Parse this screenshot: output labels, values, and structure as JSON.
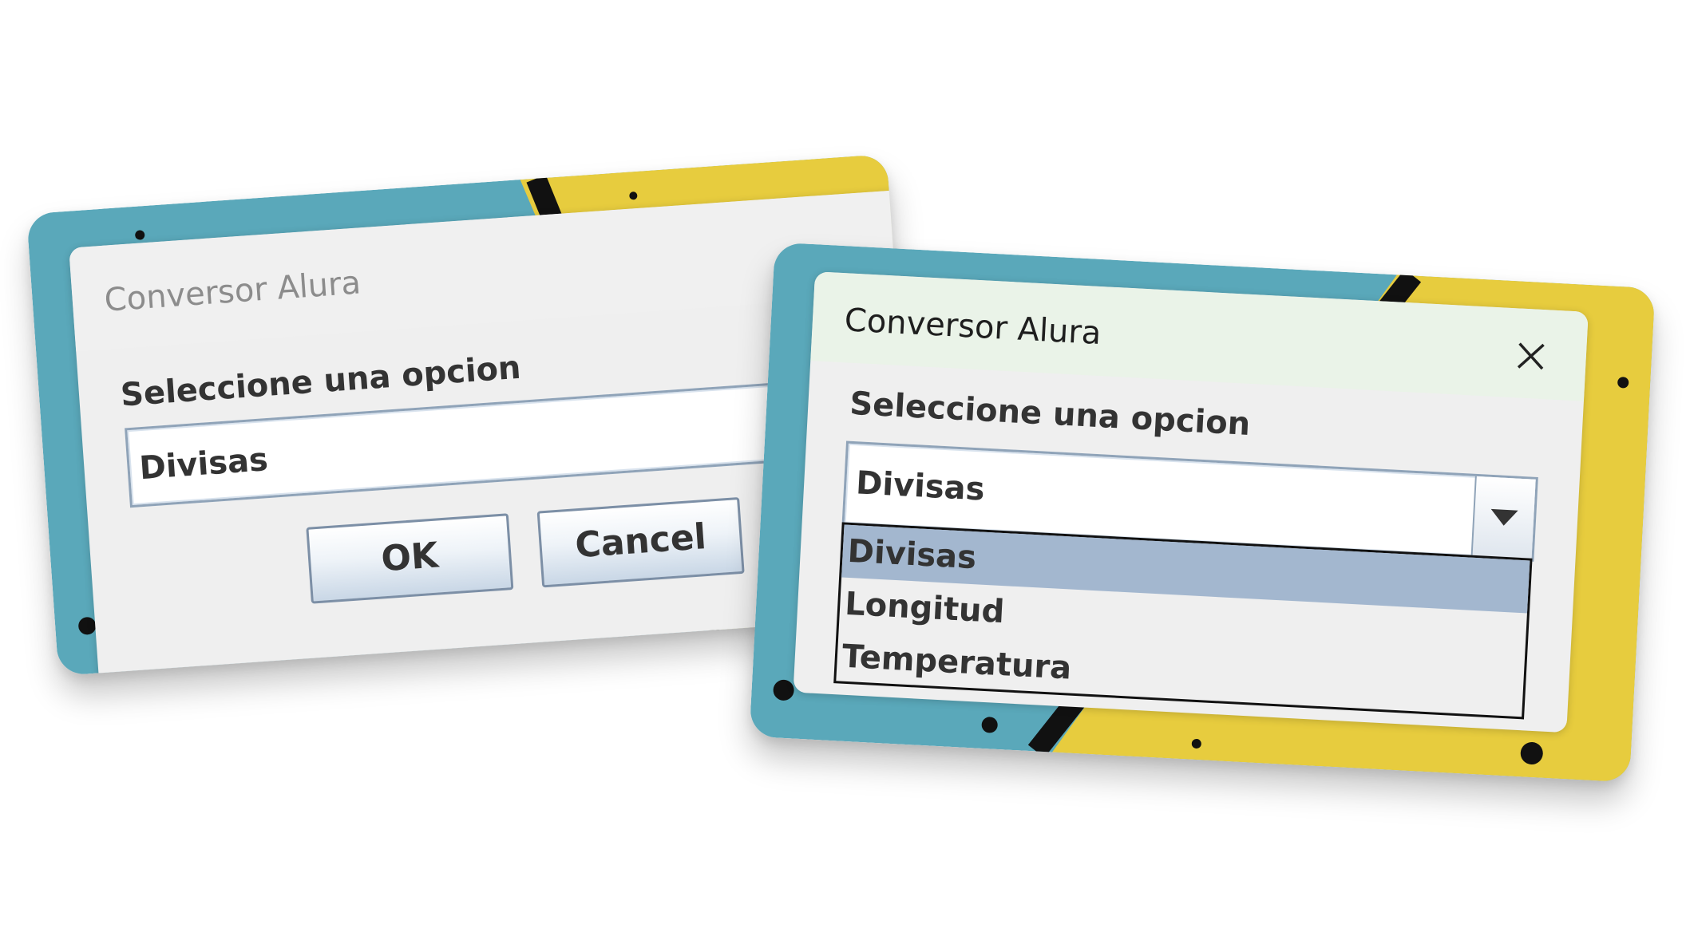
{
  "dialog_closed_state": {
    "title": "Conversor Alura",
    "prompt": "Seleccione una opcion",
    "selected_value": "Divisas",
    "buttons": {
      "ok_label": "OK",
      "cancel_label": "Cancel"
    },
    "close_icon": "close-icon"
  },
  "dialog_open_state": {
    "title": "Conversor Alura",
    "prompt": "Seleccione una opcion",
    "selected_value": "Divisas",
    "options": [
      "Divisas",
      "Longitud",
      "Temperatura"
    ],
    "highlighted_option": "Divisas",
    "close_icon": "close-icon",
    "dropdown_icon": "chevron-down-icon"
  },
  "colors": {
    "wallpaper_teal": "#5aa8ba",
    "wallpaper_yellow": "#e7cc3e",
    "selection": "#a3b7cf",
    "titlebar_active": "#eaf3e8"
  }
}
